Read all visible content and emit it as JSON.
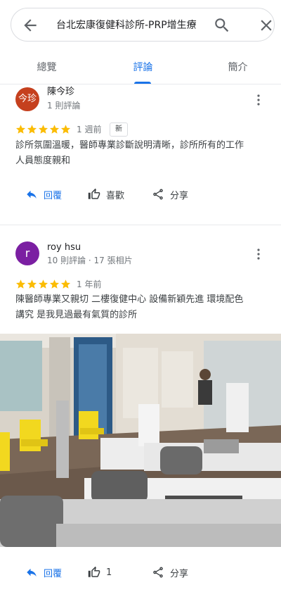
{
  "search": {
    "query": "台北宏康復健科診所-PRP增生療"
  },
  "tabs": [
    {
      "label": "總覽"
    },
    {
      "label": "評論"
    },
    {
      "label": "簡介"
    }
  ],
  "reviews": [
    {
      "avatar_text": "今珍",
      "avatar_color": "#c5401e",
      "name": "陳今珍",
      "meta": "1 則評論",
      "rating": 5,
      "time": "1 週前",
      "badge": "新",
      "text_lines": [
        "診所氛圍溫暖，醫師專業診斷說明清晰，診所所有的工作",
        "人員態度親和"
      ],
      "actions": {
        "reply": "回覆",
        "like": "喜歡",
        "share": "分享"
      }
    },
    {
      "avatar_text": "r",
      "avatar_color": "#7b1fa2",
      "name": "roy hsu",
      "meta": "10 則評論 · 17 張相片",
      "rating": 5,
      "time": "1 年前",
      "text_lines": [
        "陳醫師專業又親切 二樓復健中心 設備新穎先進 環境配色",
        "講究 是我見過最有氣質的診所"
      ],
      "actions": {
        "reply": "回覆",
        "like": "1",
        "share": "分享"
      }
    }
  ],
  "colors": {
    "accent": "#1a73e8",
    "star": "#fbbc04"
  }
}
